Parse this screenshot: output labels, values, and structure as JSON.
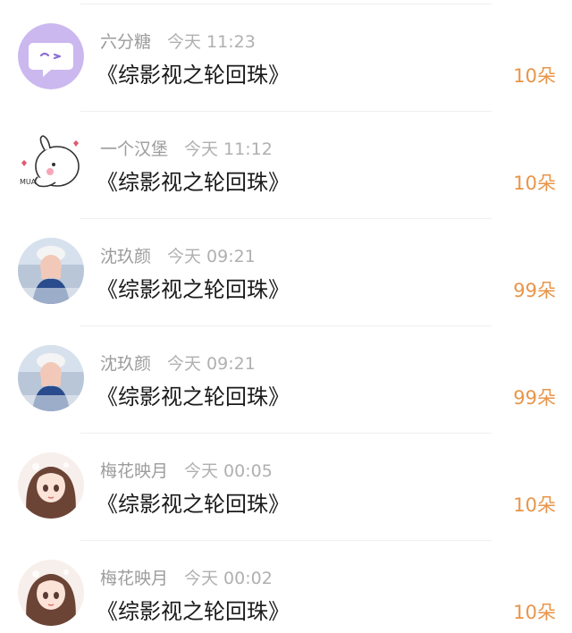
{
  "items": [
    {
      "name": "六分糖",
      "time": "今天 11:23",
      "title": "《综影视之轮回珠》",
      "amount": "10朵",
      "avatar": "chat-bubble-avatar"
    },
    {
      "name": "一个汉堡",
      "time": "今天 11:12",
      "title": "《综影视之轮回珠》",
      "amount": "10朵",
      "avatar": "bunny-sticker-avatar"
    },
    {
      "name": "沈玖颜",
      "time": "今天 09:21",
      "title": "《综影视之轮回珠》",
      "amount": "99朵",
      "avatar": "photo-avatar"
    },
    {
      "name": "沈玖颜",
      "time": "今天 09:21",
      "title": "《综影视之轮回珠》",
      "amount": "99朵",
      "avatar": "photo-avatar"
    },
    {
      "name": "梅花映月",
      "time": "今天 00:05",
      "title": "《综影视之轮回珠》",
      "amount": "10朵",
      "avatar": "anime-girl-avatar"
    },
    {
      "name": "梅花映月",
      "time": "今天 00:02",
      "title": "《综影视之轮回珠》",
      "amount": "10朵",
      "avatar": "anime-girl-avatar"
    }
  ],
  "colors": {
    "amount": "#e8954a",
    "name": "#9c9c9c",
    "title": "#1a1a1a"
  }
}
